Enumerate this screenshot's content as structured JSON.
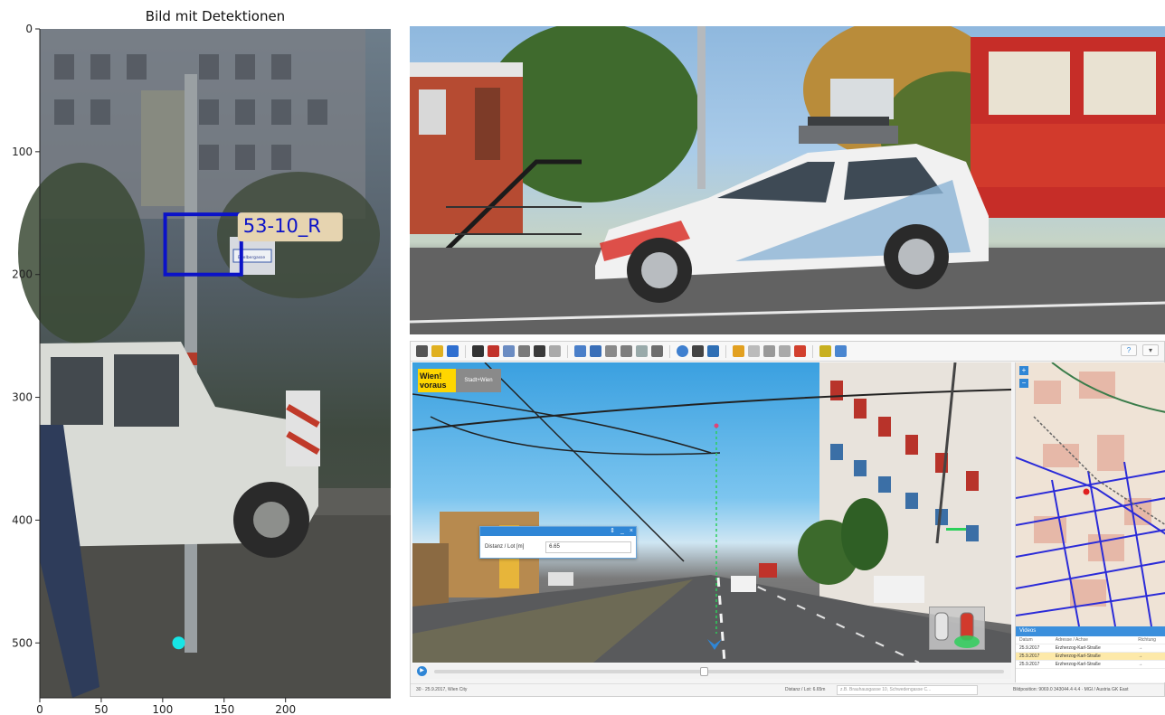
{
  "plot": {
    "title": "Bild mit Detektionen",
    "detection_label": "53-10_R",
    "sign_text": "Eitelbergasse",
    "y_ticks": [
      "0",
      "100",
      "200",
      "300",
      "400",
      "500"
    ],
    "x_ticks": [
      "0",
      "50",
      "100",
      "150",
      "200"
    ],
    "colors": {
      "box": "#0b12c8",
      "label_bg": "#e6d4b0",
      "point": "#17e5e5"
    }
  },
  "chart_data": {
    "type": "scatter",
    "title": "Bild mit Detektionen",
    "xlabel": "",
    "ylabel": "",
    "xlim": [
      0,
      248
    ],
    "ylim": [
      0,
      545
    ],
    "y_inverted": true,
    "x_ticks": [
      0,
      50,
      100,
      150,
      200
    ],
    "y_ticks": [
      0,
      100,
      200,
      300,
      400,
      500
    ],
    "detections": [
      {
        "label": "53-10_R",
        "x_min": 102,
        "y_min": 151,
        "x_max": 164,
        "y_max": 200
      }
    ],
    "points": [
      {
        "x": 113,
        "y": 500
      }
    ]
  },
  "app": {
    "logo": {
      "line1": "Wien!",
      "line2": "voraus",
      "sub": "Stadt+Wien"
    },
    "toolbar_right": [
      "?",
      "▾"
    ],
    "measure_dialog": {
      "controls": [
        "⇕",
        "_",
        "×"
      ],
      "label": "Distanz / Lot [m]",
      "value": "6.65"
    },
    "map_zoom": [
      "+",
      "−"
    ],
    "videos": {
      "title": "Videos",
      "headers": {
        "date": "Datum",
        "address": "Adresse / Achse",
        "direction": "Richtung"
      },
      "rows": [
        {
          "date": "25.9.2017",
          "address": "Erzherzog-Karl-Straße",
          "direction": "→"
        },
        {
          "date": "25.9.2017",
          "address": "Erzherzog-Karl-Straße",
          "direction": "→"
        },
        {
          "date": "25.9.2017",
          "address": "Erzherzog-Karl-Straße",
          "direction": "→"
        }
      ]
    },
    "play_symbol": "▶",
    "status": {
      "left": "30 · 25.9.2017, Wien City",
      "distance": "Distanz / Lot: 6.65m",
      "address": "z.B. Brauhausgasse 10, Schwedengasse C...",
      "right": "Bildposition: 9069.0 343044.4 4.4 · MGI / Austria GK East"
    }
  }
}
